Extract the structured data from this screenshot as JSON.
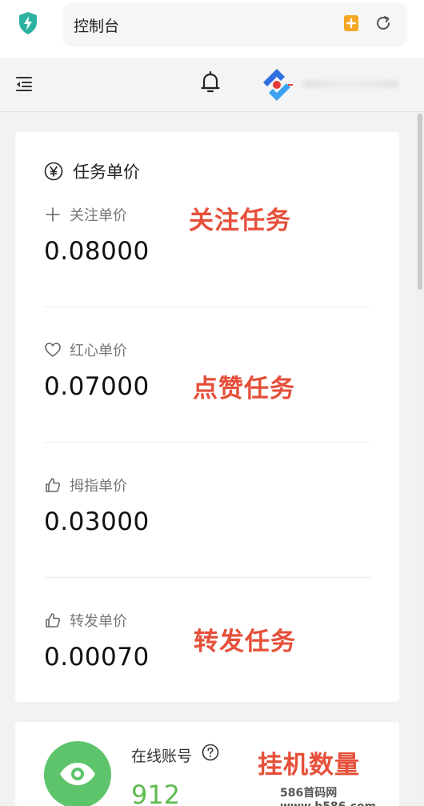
{
  "browser": {
    "address_text": "控制台",
    "icons": [
      "shield-lightning-icon",
      "bookmark-add-icon",
      "reload-icon"
    ],
    "colors": {
      "shield": "#2bb3a1",
      "bookmark": "#f5a623"
    }
  },
  "header": {
    "icons": [
      "menu-fold-icon",
      "bell-icon",
      "app-logo-icon"
    ]
  },
  "price_card": {
    "title": "任务单价",
    "items": [
      {
        "label": "关注单价",
        "value": "0.08000",
        "icon": "plus-icon"
      },
      {
        "label": "红心单价",
        "value": "0.07000",
        "icon": "heart-icon"
      },
      {
        "label": "拇指单价",
        "value": "0.03000",
        "icon": "thumbs-up-icon"
      },
      {
        "label": "转发单价",
        "value": "0.00070",
        "icon": "thumbs-up-icon"
      }
    ]
  },
  "annotations": [
    "关注任务",
    "点赞任务",
    "转发任务",
    "挂机数量"
  ],
  "online_card": {
    "label": "在线账号",
    "value": "912",
    "icon": "eye-icon",
    "colors": {
      "circle": "#5dc46b",
      "value": "#5dbb4d"
    }
  },
  "watermark": "586首码网 www.h586.com",
  "colors": {
    "annotation": "#e64f3a"
  }
}
